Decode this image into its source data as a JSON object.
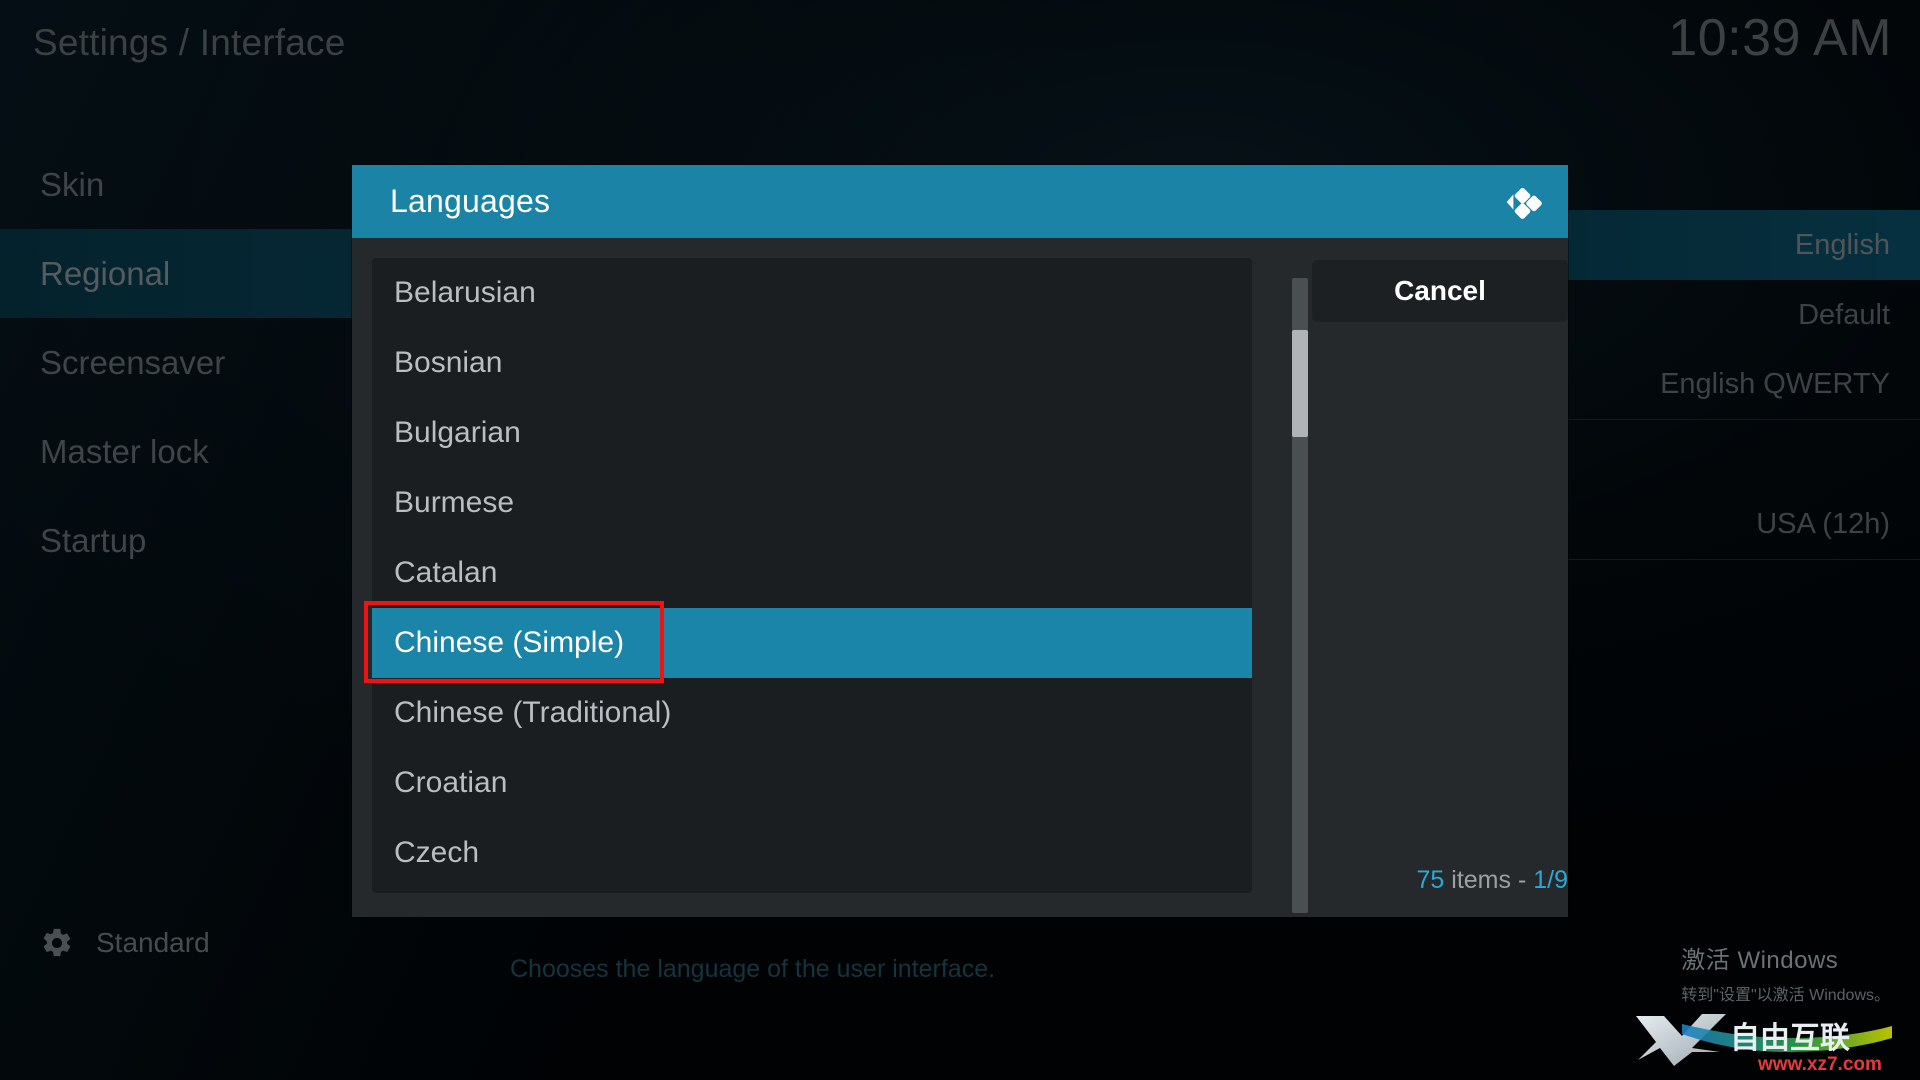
{
  "header": {
    "title": "Settings / Interface",
    "clock": "10:39 AM"
  },
  "sidebar": {
    "items": [
      {
        "label": "Skin",
        "selected": false
      },
      {
        "label": "Regional",
        "selected": true
      },
      {
        "label": "Screensaver",
        "selected": false
      },
      {
        "label": "Master lock",
        "selected": false
      },
      {
        "label": "Startup",
        "selected": false
      }
    ],
    "footer": {
      "icon": "gear-icon",
      "label": "Standard"
    }
  },
  "settings_values": [
    {
      "label": "English",
      "selected": true
    },
    {
      "label": "Default",
      "selected": false
    },
    {
      "label": "English QWERTY",
      "selected": false
    },
    {
      "label": "USA (12h)",
      "selected": false
    }
  ],
  "description": "Chooses the language of the user interface.",
  "dialog": {
    "title": "Languages",
    "logo": "kodi-logo",
    "cancel_label": "Cancel",
    "count_prefix": "75",
    "count_middle": " items - ",
    "count_page": "1/9",
    "items": [
      {
        "label": "Belarusian",
        "highlighted": false
      },
      {
        "label": "Bosnian",
        "highlighted": false
      },
      {
        "label": "Bulgarian",
        "highlighted": false
      },
      {
        "label": "Burmese",
        "highlighted": false
      },
      {
        "label": "Catalan",
        "highlighted": false
      },
      {
        "label": "Chinese (Simple)",
        "highlighted": true
      },
      {
        "label": "Chinese (Traditional)",
        "highlighted": false
      },
      {
        "label": "Croatian",
        "highlighted": false
      },
      {
        "label": "Czech",
        "highlighted": false
      }
    ]
  },
  "watermarks": {
    "windows_line1": "激活 Windows",
    "windows_line2": "转到\"设置\"以激活 Windows。",
    "site_text": "自由互联",
    "site_url": "www.xz7.com",
    "site_mark": "X"
  },
  "colors": {
    "accent": "#1a85a8",
    "header_teal": "#1a83a6",
    "annotation_red": "#ef1414",
    "count_accent": "#2ba8d4"
  }
}
